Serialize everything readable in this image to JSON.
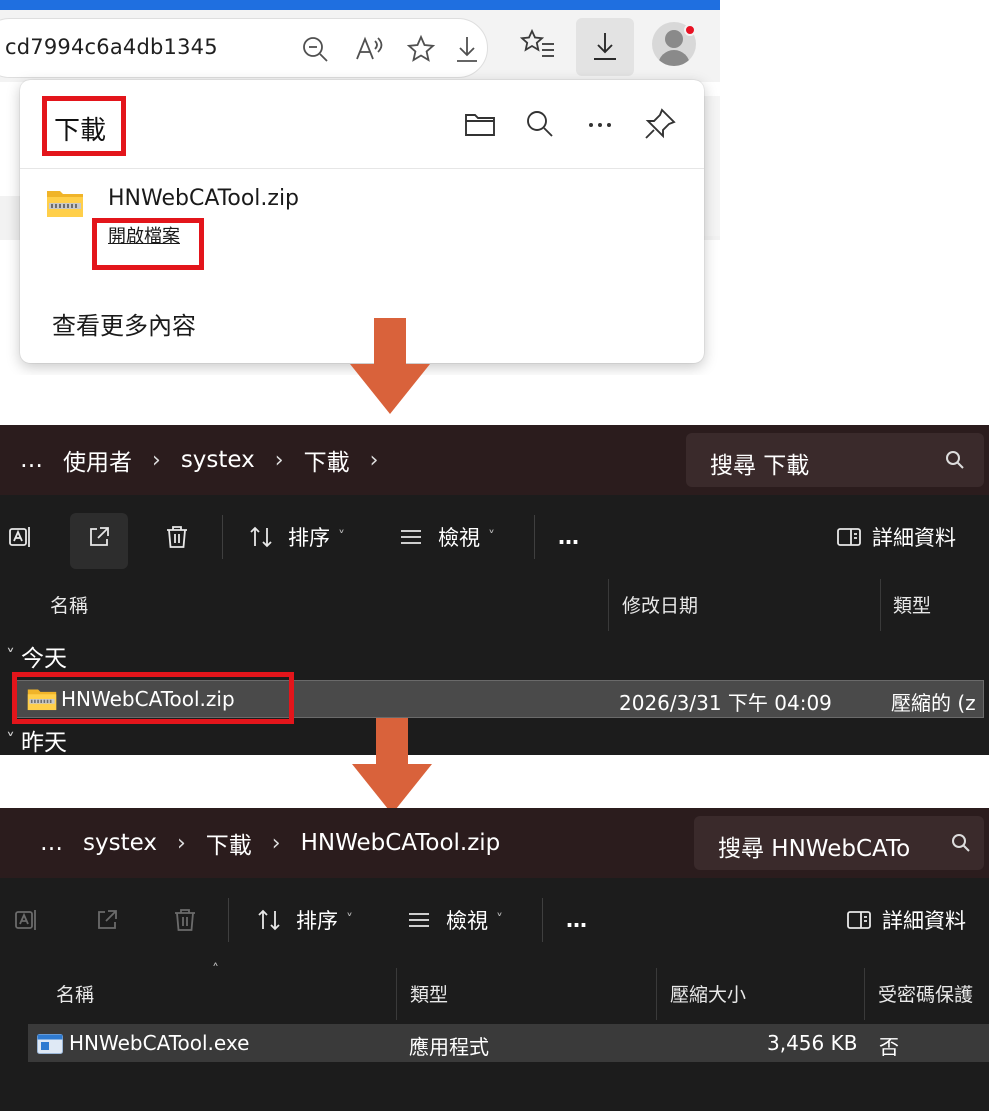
{
  "browser": {
    "address_url": "cd7994c6a4db1345",
    "icons": [
      "zoom-out-icon",
      "read-aloud-icon",
      "favorite-star-icon",
      "download-icon",
      "favorites-list-icon",
      "downloads-button-icon",
      "profile-avatar-icon"
    ],
    "downloads_panel": {
      "title": "下載",
      "file_name": "HNWebCATool.zip",
      "open_file_label": "開啟檔案",
      "see_more_label": "查看更多內容",
      "header_icons": [
        "open-folder-icon",
        "search-icon",
        "more-icon",
        "pin-icon"
      ]
    }
  },
  "explorer1": {
    "breadcrumbs": [
      "…",
      "使用者",
      "systex",
      "下載"
    ],
    "search_placeholder": "搜尋 下載",
    "toolbar": {
      "sort_label": "排序",
      "view_label": "檢視",
      "more_label": "…",
      "details_label": "詳細資料"
    },
    "columns": [
      "名稱",
      "修改日期",
      "類型"
    ],
    "groups": {
      "today": "今天",
      "yesterday": "昨天"
    },
    "rows": [
      {
        "name": "HNWebCATool.zip",
        "modified": "2026/3/31 下午 04:09",
        "type": "壓縮的 (z"
      }
    ]
  },
  "explorer2": {
    "breadcrumbs": [
      "…",
      "systex",
      "下載",
      "HNWebCATool.zip"
    ],
    "search_placeholder": "搜尋 HNWebCATo",
    "toolbar": {
      "sort_label": "排序",
      "view_label": "檢視",
      "more_label": "…",
      "details_label": "詳細資料"
    },
    "columns": [
      "名稱",
      "類型",
      "壓縮大小",
      "受密碼保護"
    ],
    "rows": [
      {
        "name": "HNWebCATool.exe",
        "type": "應用程式",
        "size": "3,456 KB",
        "protected": "否"
      }
    ]
  },
  "colors": {
    "highlight_red": "#e3151b",
    "arrow_orange": "#d9623b",
    "explorer_bg": "#1c1c1c",
    "explorer_top": "#2b1c1d"
  }
}
